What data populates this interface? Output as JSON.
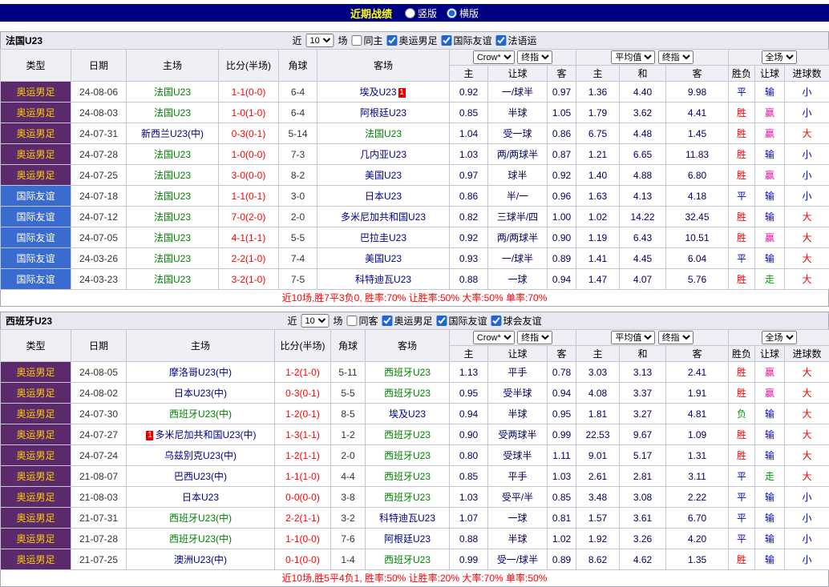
{
  "topbar": {
    "title": "近期战绩",
    "options": [
      {
        "label": "竖版",
        "selected": false
      },
      {
        "label": "横版",
        "selected": true
      }
    ]
  },
  "color_map": {
    "胜": "red",
    "平": "blue",
    "负": "green",
    "赢": "magenta",
    "输": "blue",
    "走": "green",
    "大": "red",
    "小": "blue"
  },
  "type_styles": {
    "奥运男足": "olympic",
    "国际友谊": "friendly"
  },
  "sections": [
    {
      "team": "法国U23",
      "filter": {
        "recent_prefix": "近",
        "recent_value": "10",
        "recent_suffix": "场",
        "checkboxes": [
          {
            "label": "同主",
            "checked": false
          },
          {
            "label": "奥运男足",
            "checked": true
          },
          {
            "label": "国际友谊",
            "checked": true
          },
          {
            "label": "法语运",
            "checked": true
          }
        ]
      },
      "header": {
        "cols": [
          "类型",
          "日期",
          "主场",
          "比分(半场)",
          "角球",
          "客场"
        ],
        "book_select": "Crow*",
        "time_select": "终指",
        "avg_select": "平均值",
        "time_select2": "终指",
        "scope_select": "全场",
        "subcols": [
          "主",
          "让球",
          "客",
          "主",
          "和",
          "客",
          "胜负",
          "让球",
          "进球数"
        ]
      },
      "rows": [
        {
          "type": "奥运男足",
          "date": "24-08-06",
          "home": "法国U23",
          "score": "1-1(0-0)",
          "corner": "6-4",
          "away": "埃及U23",
          "away_badge": "1",
          "away_badge_pos": "after",
          "odds": [
            "0.92",
            "一/球半",
            "0.97"
          ],
          "avg": [
            "1.36",
            "4.40",
            "9.98"
          ],
          "results": [
            "平",
            "输",
            "小"
          ]
        },
        {
          "type": "奥运男足",
          "date": "24-08-03",
          "home": "法国U23",
          "score": "1-0(1-0)",
          "corner": "6-4",
          "away": "阿根廷U23",
          "odds": [
            "0.85",
            "半球",
            "1.05"
          ],
          "avg": [
            "1.79",
            "3.62",
            "4.41"
          ],
          "results": [
            "胜",
            "赢",
            "小"
          ]
        },
        {
          "type": "奥运男足",
          "date": "24-07-31",
          "home": "新西兰U23(中)",
          "score": "0-3(0-1)",
          "corner": "5-14",
          "away": "法国U23",
          "odds": [
            "1.04",
            "受一球",
            "0.86"
          ],
          "avg": [
            "6.75",
            "4.48",
            "1.45"
          ],
          "results": [
            "胜",
            "赢",
            "大"
          ]
        },
        {
          "type": "奥运男足",
          "date": "24-07-28",
          "home": "法国U23",
          "score": "1-0(0-0)",
          "corner": "7-3",
          "away": "几内亚U23",
          "odds": [
            "1.03",
            "两/两球半",
            "0.87"
          ],
          "avg": [
            "1.21",
            "6.65",
            "11.83"
          ],
          "results": [
            "胜",
            "输",
            "小"
          ]
        },
        {
          "type": "奥运男足",
          "date": "24-07-25",
          "home": "法国U23",
          "score": "3-0(0-0)",
          "corner": "8-2",
          "away": "美国U23",
          "odds": [
            "0.97",
            "球半",
            "0.92"
          ],
          "avg": [
            "1.40",
            "4.88",
            "6.80"
          ],
          "results": [
            "胜",
            "赢",
            "小"
          ]
        },
        {
          "type": "国际友谊",
          "date": "24-07-18",
          "home": "法国U23",
          "score": "1-1(0-1)",
          "corner": "3-0",
          "away": "日本U23",
          "odds": [
            "0.86",
            "半/一",
            "0.96"
          ],
          "avg": [
            "1.63",
            "4.13",
            "4.18"
          ],
          "results": [
            "平",
            "输",
            "小"
          ]
        },
        {
          "type": "国际友谊",
          "date": "24-07-12",
          "home": "法国U23",
          "score": "7-0(2-0)",
          "corner": "2-0",
          "away": "多米尼加共和国U23",
          "odds": [
            "0.82",
            "三球半/四",
            "1.00"
          ],
          "avg": [
            "1.02",
            "14.22",
            "32.45"
          ],
          "results": [
            "胜",
            "输",
            "大"
          ]
        },
        {
          "type": "国际友谊",
          "date": "24-07-05",
          "home": "法国U23",
          "score": "4-1(1-1)",
          "corner": "5-5",
          "away": "巴拉圭U23",
          "odds": [
            "0.92",
            "两/两球半",
            "0.90"
          ],
          "avg": [
            "1.19",
            "6.43",
            "10.51"
          ],
          "results": [
            "胜",
            "赢",
            "大"
          ]
        },
        {
          "type": "国际友谊",
          "date": "24-03-26",
          "home": "法国U23",
          "score": "2-2(1-0)",
          "corner": "7-4",
          "away": "美国U23",
          "odds": [
            "0.93",
            "一/球半",
            "0.89"
          ],
          "avg": [
            "1.41",
            "4.45",
            "6.04"
          ],
          "results": [
            "平",
            "输",
            "大"
          ]
        },
        {
          "type": "国际友谊",
          "date": "24-03-23",
          "home": "法国U23",
          "score": "3-2(1-0)",
          "corner": "7-5",
          "away": "科特迪瓦U23",
          "odds": [
            "0.88",
            "一球",
            "0.94"
          ],
          "avg": [
            "1.47",
            "4.07",
            "5.76"
          ],
          "results": [
            "胜",
            "走",
            "大"
          ]
        }
      ],
      "footer": "近10场,胜7平3负0, 胜率:70% 让胜率:50% 大率:50% 单率:70%"
    },
    {
      "team": "西班牙U23",
      "filter": {
        "recent_prefix": "近",
        "recent_value": "10",
        "recent_suffix": "场",
        "checkboxes": [
          {
            "label": "同客",
            "checked": false
          },
          {
            "label": "奥运男足",
            "checked": true
          },
          {
            "label": "国际友谊",
            "checked": true
          },
          {
            "label": "球会友谊",
            "checked": true
          }
        ]
      },
      "header": {
        "cols": [
          "类型",
          "日期",
          "主场",
          "比分(半场)",
          "角球",
          "客场"
        ],
        "book_select": "Crow*",
        "time_select": "终指",
        "avg_select": "平均值",
        "time_select2": "终指",
        "scope_select": "全场",
        "subcols": [
          "主",
          "让球",
          "客",
          "主",
          "和",
          "客",
          "胜负",
          "让球",
          "进球数"
        ]
      },
      "rows": [
        {
          "type": "奥运男足",
          "date": "24-08-05",
          "home": "摩洛哥U23(中)",
          "score": "1-2(1-0)",
          "corner": "5-11",
          "away": "西班牙U23",
          "odds": [
            "1.13",
            "平手",
            "0.78"
          ],
          "avg": [
            "3.03",
            "3.13",
            "2.41"
          ],
          "results": [
            "胜",
            "赢",
            "大"
          ]
        },
        {
          "type": "奥运男足",
          "date": "24-08-02",
          "home": "日本U23(中)",
          "score": "0-3(0-1)",
          "corner": "5-5",
          "away": "西班牙U23",
          "odds": [
            "0.95",
            "受半球",
            "0.94"
          ],
          "avg": [
            "4.08",
            "3.37",
            "1.91"
          ],
          "results": [
            "胜",
            "赢",
            "大"
          ]
        },
        {
          "type": "奥运男足",
          "date": "24-07-30",
          "home": "西班牙U23(中)",
          "score": "1-2(0-1)",
          "corner": "8-5",
          "away": "埃及U23",
          "odds": [
            "0.94",
            "半球",
            "0.95"
          ],
          "avg": [
            "1.81",
            "3.27",
            "4.81"
          ],
          "results": [
            "负",
            "输",
            "大"
          ]
        },
        {
          "type": "奥运男足",
          "date": "24-07-27",
          "home": "多米尼加共和国U23(中)",
          "home_badge": "1",
          "home_badge_pos": "before",
          "score": "1-3(1-1)",
          "corner": "1-2",
          "away": "西班牙U23",
          "odds": [
            "0.90",
            "受两球半",
            "0.99"
          ],
          "avg": [
            "22.53",
            "9.67",
            "1.09"
          ],
          "results": [
            "胜",
            "输",
            "大"
          ]
        },
        {
          "type": "奥运男足",
          "date": "24-07-24",
          "home": "乌兹别克U23(中)",
          "score": "1-2(1-1)",
          "corner": "2-0",
          "away": "西班牙U23",
          "odds": [
            "0.80",
            "受球半",
            "1.11"
          ],
          "avg": [
            "9.01",
            "5.17",
            "1.31"
          ],
          "results": [
            "胜",
            "输",
            "大"
          ]
        },
        {
          "type": "奥运男足",
          "date": "21-08-07",
          "home": "巴西U23(中)",
          "score": "1-1(1-0)",
          "corner": "4-4",
          "away": "西班牙U23",
          "odds": [
            "0.85",
            "平手",
            "1.03"
          ],
          "avg": [
            "2.61",
            "2.81",
            "3.11"
          ],
          "results": [
            "平",
            "走",
            "大"
          ]
        },
        {
          "type": "奥运男足",
          "date": "21-08-03",
          "home": "日本U23",
          "score": "0-0(0-0)",
          "corner": "3-8",
          "away": "西班牙U23",
          "odds": [
            "1.03",
            "受平/半",
            "0.85"
          ],
          "avg": [
            "3.48",
            "3.08",
            "2.22"
          ],
          "results": [
            "平",
            "输",
            "小"
          ]
        },
        {
          "type": "奥运男足",
          "date": "21-07-31",
          "home": "西班牙U23(中)",
          "score": "2-2(1-1)",
          "corner": "3-2",
          "away": "科特迪瓦U23",
          "odds": [
            "1.07",
            "一球",
            "0.81"
          ],
          "avg": [
            "1.57",
            "3.61",
            "6.70"
          ],
          "results": [
            "平",
            "输",
            "小"
          ]
        },
        {
          "type": "奥运男足",
          "date": "21-07-28",
          "home": "西班牙U23(中)",
          "score": "1-1(0-0)",
          "corner": "7-6",
          "away": "阿根廷U23",
          "odds": [
            "0.88",
            "半球",
            "1.02"
          ],
          "avg": [
            "1.92",
            "3.26",
            "4.20"
          ],
          "results": [
            "平",
            "输",
            "小"
          ]
        },
        {
          "type": "奥运男足",
          "date": "21-07-25",
          "home": "澳洲U23(中)",
          "score": "0-1(0-0)",
          "corner": "1-4",
          "away": "西班牙U23",
          "odds": [
            "0.99",
            "受一/球半",
            "0.89"
          ],
          "avg": [
            "8.62",
            "4.62",
            "1.35"
          ],
          "results": [
            "胜",
            "输",
            "小"
          ]
        }
      ],
      "footer": "近10场,胜5平4负1, 胜率:50% 让胜率:20% 大率:70% 单率:50%"
    }
  ]
}
